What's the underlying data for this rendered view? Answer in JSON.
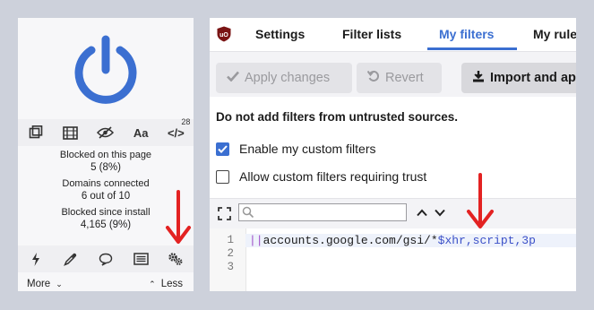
{
  "popup": {
    "toolbar": {
      "items": [
        {
          "icon": "element-picker-icon"
        },
        {
          "icon": "media-icon"
        },
        {
          "icon": "eye-slash-icon"
        },
        {
          "icon": "fonts-icon",
          "label": "Aa"
        },
        {
          "icon": "code-icon",
          "label": "</>",
          "badge": "28"
        }
      ]
    },
    "stats": {
      "blocked_page_label": "Blocked on this page",
      "blocked_page_value": "5 (8%)",
      "domains_label": "Domains connected",
      "domains_value": "6 out of 10",
      "blocked_install_label": "Blocked since install",
      "blocked_install_value": "4,165 (9%)"
    },
    "bottom_tools": [
      "lightning-icon",
      "eyedropper-icon",
      "chat-bubble-icon",
      "logger-icon",
      "settings-gears-icon"
    ],
    "more_label": "More",
    "less_label": "Less"
  },
  "dashboard": {
    "tabs": [
      {
        "label": "Settings",
        "active": false
      },
      {
        "label": "Filter lists",
        "active": false
      },
      {
        "label": "My filters",
        "active": true
      },
      {
        "label": "My rule",
        "active": false
      }
    ],
    "apply_label": "Apply changes",
    "revert_label": "Revert",
    "import_label": "Import and ap",
    "warning": "Do not add filters from untrusted sources.",
    "enable_custom_label": "Enable my custom filters",
    "enable_custom_checked": true,
    "allow_trust_label": "Allow custom filters requiring trust",
    "allow_trust_checked": false,
    "search_placeholder": "",
    "line_numbers": [
      "1",
      "2",
      "3"
    ],
    "code": {
      "prefix": "||",
      "host": "accounts.google.com/gsi/*",
      "options": "$xhr,script,3p"
    }
  },
  "colors": {
    "accent": "#3b6fd1",
    "annotation_arrow": "#e32222",
    "power_icon": "#3b6fd1"
  }
}
